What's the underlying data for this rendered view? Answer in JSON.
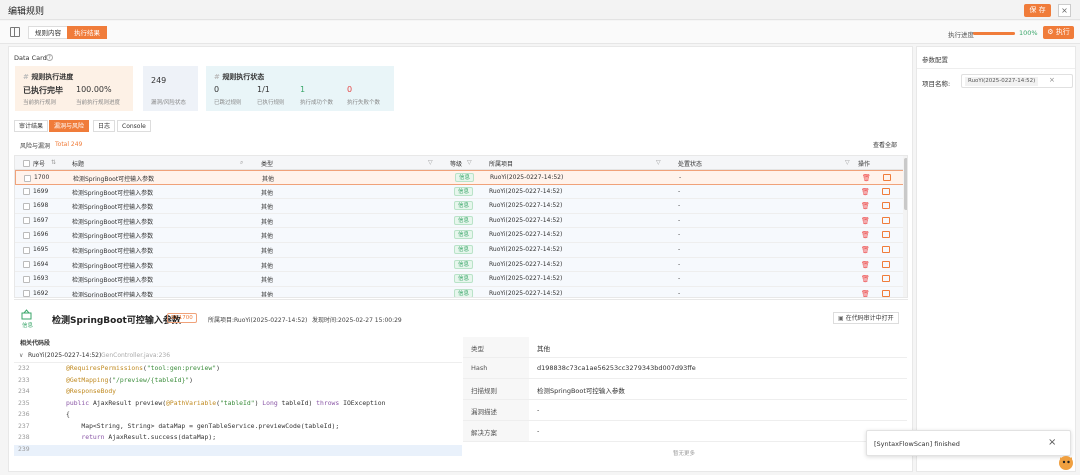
{
  "window": {
    "title": "编辑规则",
    "save_label": "保 存"
  },
  "tabs": {
    "items": [
      {
        "label": "规则内容"
      },
      {
        "label": "执行结果"
      }
    ]
  },
  "progress": {
    "label": "执行进度",
    "value_text": "100%",
    "value": 1.0,
    "run_label": "执行"
  },
  "data_card": {
    "title": "Data Card"
  },
  "progress_card": {
    "title": "规则执行进度",
    "status": "已执行完毕",
    "percent": "100.00%",
    "l1": "当前执行规则",
    "l2": "当前执行规则进度"
  },
  "risk_card": {
    "count": "249",
    "label": "漏洞/风险状态"
  },
  "state_card": {
    "title": "规则执行状态",
    "items": [
      {
        "value": "0",
        "label": "已跳过规则"
      },
      {
        "value": "1/1",
        "label": "已执行规则"
      },
      {
        "value": "1",
        "label": "执行成功个数"
      },
      {
        "value": "0",
        "label": "执行失败个数"
      }
    ]
  },
  "sub_tabs": {
    "items": [
      {
        "label": "审计结果"
      },
      {
        "label": "漏洞与风险"
      },
      {
        "label": "日志"
      },
      {
        "label": "Console"
      }
    ]
  },
  "risk_list": {
    "title": "风险与漏洞",
    "total": "Total 249",
    "view_all": "查看全部"
  },
  "table": {
    "headers": {
      "no": "序号",
      "title": "标题",
      "type": "类型",
      "level": "等级",
      "project": "所属项目",
      "status": "处置状态",
      "ops": "操作"
    },
    "rows": [
      {
        "id": "1700",
        "title": "检测SpringBoot可控输入参数",
        "type": "其他",
        "level": "信息",
        "project": "RuoYi(2025-0227-14:52)",
        "status": "-"
      },
      {
        "id": "1699",
        "title": "检测SpringBoot可控输入参数",
        "type": "其他",
        "level": "信息",
        "project": "RuoYi(2025-0227-14:52)",
        "status": "-"
      },
      {
        "id": "1698",
        "title": "检测SpringBoot可控输入参数",
        "type": "其他",
        "level": "信息",
        "project": "RuoYi(2025-0227-14:52)",
        "status": "-"
      },
      {
        "id": "1697",
        "title": "检测SpringBoot可控输入参数",
        "type": "其他",
        "level": "信息",
        "project": "RuoYi(2025-0227-14:52)",
        "status": "-"
      },
      {
        "id": "1696",
        "title": "检测SpringBoot可控输入参数",
        "type": "其他",
        "level": "信息",
        "project": "RuoYi(2025-0227-14:52)",
        "status": "-"
      },
      {
        "id": "1695",
        "title": "检测SpringBoot可控输入参数",
        "type": "其他",
        "level": "信息",
        "project": "RuoYi(2025-0227-14:52)",
        "status": "-"
      },
      {
        "id": "1694",
        "title": "检测SpringBoot可控输入参数",
        "type": "其他",
        "level": "信息",
        "project": "RuoYi(2025-0227-14:52)",
        "status": "-"
      },
      {
        "id": "1693",
        "title": "检测SpringBoot可控输入参数",
        "type": "其他",
        "level": "信息",
        "project": "RuoYi(2025-0227-14:52)",
        "status": "-"
      },
      {
        "id": "1692",
        "title": "检测SpringBoot可控输入参数",
        "type": "其他",
        "level": "信息",
        "project": "RuoYi(2025-0227-14:52)",
        "status": "-"
      }
    ]
  },
  "detail": {
    "level": "信息",
    "title": "检测SpringBoot可控输入参数",
    "id_badge": "ID:1700",
    "project": "所属项目:RuoYi(2025-0227-14:52)",
    "time": "发现时间:2025-02-27 15:00:29",
    "open_btn": "在代码审计中打开",
    "code_section": "相关代码段",
    "file_project": "RuoYi(2025-0227-14:52)",
    "file_name": "GenController.java:236",
    "code": [
      {
        "ln": "232",
        "text": "@RequiresPermissions(\"tool:gen:preview\")"
      },
      {
        "ln": "233",
        "text": "@GetMapping(\"/preview/{tableId}\")"
      },
      {
        "ln": "234",
        "text": "@ResponseBody"
      },
      {
        "ln": "235",
        "text": "public AjaxResult preview(@PathVariable(\"tableId\") Long tableId) throws IOException"
      },
      {
        "ln": "236",
        "text": "{"
      },
      {
        "ln": "237",
        "text": "    Map<String, String> dataMap = genTableService.previewCode(tableId);"
      },
      {
        "ln": "238",
        "text": "    return AjaxResult.success(dataMap);"
      },
      {
        "ln": "239",
        "text": ""
      }
    ],
    "props": [
      {
        "k": "类型",
        "v": "其他"
      },
      {
        "k": "Hash",
        "v": "d198838c73ca1ae56253cc3279343bd007d93ffe"
      },
      {
        "k": "扫描规则",
        "v": "检测SpringBoot可控输入参数"
      },
      {
        "k": "漏洞描述",
        "v": "-"
      },
      {
        "k": "解决方案",
        "v": "-"
      }
    ],
    "no_more": "暂无更多"
  },
  "params": {
    "title": "参数配置",
    "project_label": "项目名称:",
    "project_value": "RuoYi(2025-0227-14:52)"
  },
  "toast": {
    "text": "[SyntaxFlowScan] finished"
  },
  "colors": {
    "accent": "#f07c3a",
    "success": "#3aa66a",
    "danger": "#e44444"
  }
}
